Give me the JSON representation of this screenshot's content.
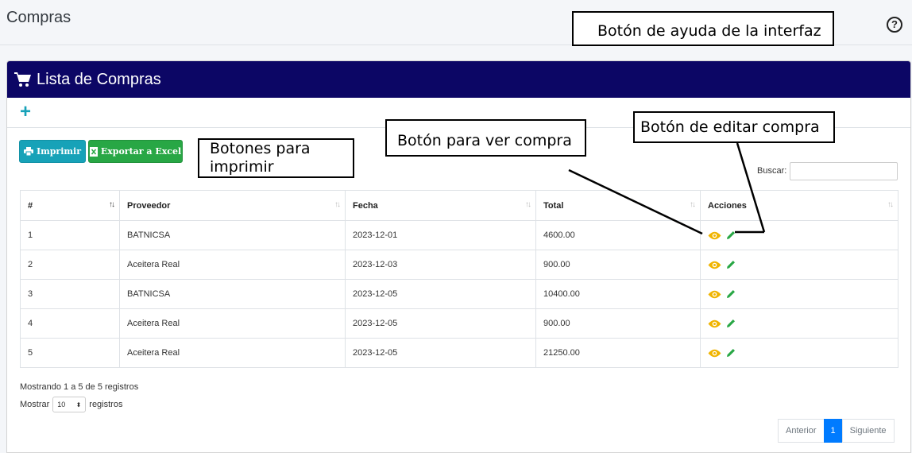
{
  "header": {
    "title": "Compras"
  },
  "card": {
    "title": "Lista de Compras"
  },
  "buttons": {
    "print": "Imprimir",
    "excel": "Exportar a Excel"
  },
  "search": {
    "label": "Buscar:",
    "value": ""
  },
  "table": {
    "columns": [
      "#",
      "Proveedor",
      "Fecha",
      "Total",
      "Acciones"
    ],
    "rows": [
      [
        "1",
        "BATNICSA",
        "2023-12-01",
        "4600.00"
      ],
      [
        "2",
        "Aceitera Real",
        "2023-12-03",
        "900.00"
      ],
      [
        "3",
        "BATNICSA",
        "2023-12-05",
        "10400.00"
      ],
      [
        "4",
        "Aceitera Real",
        "2023-12-05",
        "900.00"
      ],
      [
        "5",
        "Aceitera Real",
        "2023-12-05",
        "21250.00"
      ]
    ]
  },
  "footer": {
    "info": "Mostrando 1 a 5 de 5 registros",
    "show_label": "Mostrar",
    "page_size": "10",
    "records_label": "registros",
    "prev": "Anterior",
    "page": "1",
    "next": "Siguiente"
  },
  "annotations": {
    "help": "Botón de ayuda de la interfaz",
    "print": "Botones para imprimir",
    "view": "Botón para ver compra",
    "edit": "Botón de editar compra"
  },
  "colors": {
    "header": "#0c0665",
    "info": "#17a2b8",
    "success": "#28a745",
    "eye": "#f0b400",
    "pencil": "#28a745"
  }
}
